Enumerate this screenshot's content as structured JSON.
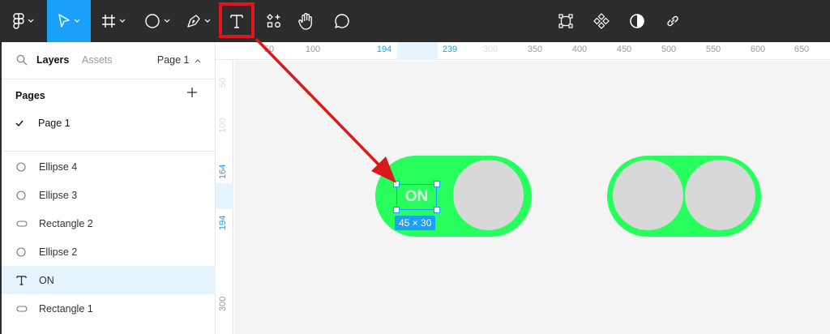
{
  "toolbar": {
    "tools": [
      {
        "name": "main-menu",
        "icon": "figma-logo-icon"
      },
      {
        "name": "move-tool",
        "icon": "pointer-icon",
        "active": true
      },
      {
        "name": "frame-tool",
        "icon": "frame-icon"
      },
      {
        "name": "shape-tool",
        "icon": "ellipse-icon"
      },
      {
        "name": "pen-tool",
        "icon": "pen-icon"
      },
      {
        "name": "text-tool",
        "icon": "text-icon",
        "highlighted": true
      },
      {
        "name": "resources-tool",
        "icon": "resources-icon"
      },
      {
        "name": "hand-tool",
        "icon": "hand-icon"
      },
      {
        "name": "comment-tool",
        "icon": "comment-icon"
      }
    ],
    "right_tools": [
      {
        "name": "boolean-groups",
        "icon": "component-frame-icon"
      },
      {
        "name": "create-component",
        "icon": "component-icon"
      },
      {
        "name": "mask",
        "icon": "contrast-icon"
      },
      {
        "name": "link",
        "icon": "link-icon"
      }
    ],
    "accent_color": "#18a0fb",
    "highlight_color": "#e0141b"
  },
  "left_panel": {
    "tabs": {
      "layers": "Layers",
      "assets": "Assets"
    },
    "page_selector": "Page 1",
    "pages_header": "Pages",
    "pages": [
      {
        "name": "Page 1",
        "current": true
      }
    ],
    "layers": [
      {
        "name": "Ellipse 4",
        "icon": "ellipse-icon",
        "selected": false
      },
      {
        "name": "Ellipse 3",
        "icon": "ellipse-icon",
        "selected": false
      },
      {
        "name": "Rectangle 2",
        "icon": "rectangle-icon",
        "selected": false
      },
      {
        "name": "Ellipse 2",
        "icon": "ellipse-icon",
        "selected": false
      },
      {
        "name": "ON",
        "icon": "text-icon",
        "selected": true
      },
      {
        "name": "Rectangle 1",
        "icon": "rectangle-icon",
        "selected": false
      }
    ]
  },
  "ruler": {
    "top_labels": [
      "50",
      "100",
      "194",
      "239",
      "300",
      "350",
      "400",
      "450",
      "500",
      "550",
      "600",
      "650"
    ],
    "left_labels": [
      "50",
      "100",
      "164",
      "194",
      "300"
    ]
  },
  "canvas": {
    "selected_text": "ON",
    "size_badge": "45 × 30",
    "toggle_color": "#26ff5c",
    "knob_color": "#d8d8d8"
  }
}
